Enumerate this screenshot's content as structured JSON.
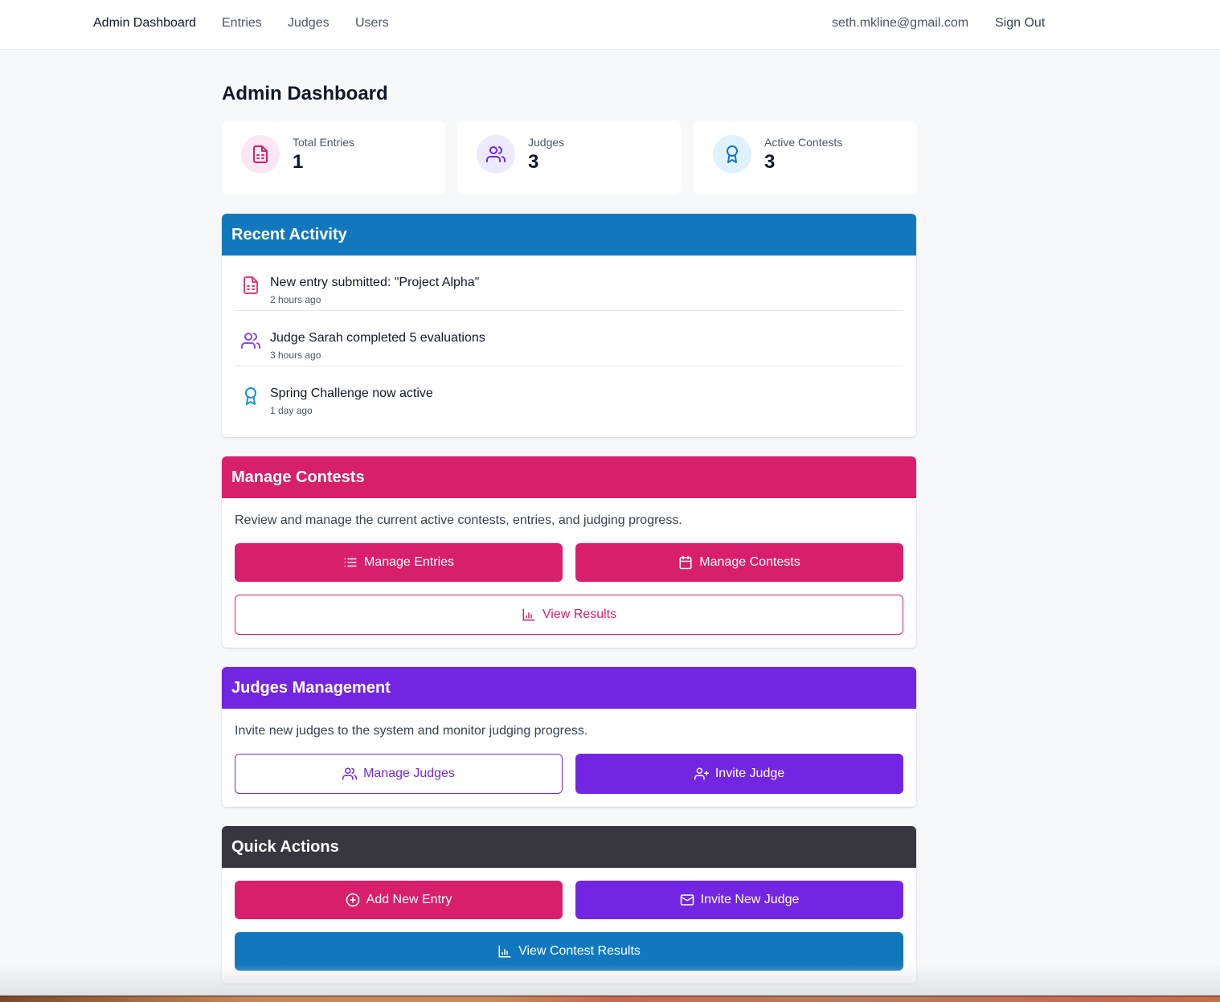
{
  "nav": {
    "links": [
      {
        "label": "Admin Dashboard",
        "active": true
      },
      {
        "label": "Entries",
        "active": false
      },
      {
        "label": "Judges",
        "active": false
      },
      {
        "label": "Users",
        "active": false
      }
    ],
    "user_email": "seth.mkline@gmail.com",
    "sign_out_label": "Sign Out"
  },
  "page": {
    "title": "Admin Dashboard"
  },
  "stats": [
    {
      "label": "Total Entries",
      "value": "1",
      "icon": "file-spreadsheet-icon",
      "color": "#d81f6c",
      "bg": "#fce7f3"
    },
    {
      "label": "Judges",
      "value": "3",
      "icon": "users-icon",
      "color": "#7326e2",
      "bg": "#ede9fe"
    },
    {
      "label": "Active Contests",
      "value": "3",
      "icon": "award-icon",
      "color": "#1278bd",
      "bg": "#e0f2fe"
    }
  ],
  "recent_activity": {
    "title": "Recent Activity",
    "header_color": "#1278bd",
    "items": [
      {
        "text": "New entry submitted: \"Project Alpha\"",
        "time": "2 hours ago",
        "icon": "file-spreadsheet-icon"
      },
      {
        "text": "Judge Sarah completed 5 evaluations",
        "time": "3 hours ago",
        "icon": "users-icon"
      },
      {
        "text": "Spring Challenge now active",
        "time": "1 day ago",
        "icon": "award-icon"
      }
    ]
  },
  "manage_contests": {
    "title": "Manage Contests",
    "header_color": "#d81f6c",
    "description": "Review and manage the current active contests, entries, and judging progress.",
    "buttons": {
      "manage_entries": "Manage Entries",
      "manage_contests": "Manage Contests",
      "view_results": "View Results"
    }
  },
  "judges_management": {
    "title": "Judges Management",
    "header_color": "#7326e2",
    "description": "Invite new judges to the system and monitor judging progress.",
    "buttons": {
      "manage_judges": "Manage Judges",
      "invite_judge": "Invite Judge"
    }
  },
  "quick_actions": {
    "title": "Quick Actions",
    "header_color": "#38373d",
    "buttons": {
      "add_new_entry": "Add New Entry",
      "invite_new_judge": "Invite New Judge",
      "view_contest_results": "View Contest Results"
    }
  }
}
